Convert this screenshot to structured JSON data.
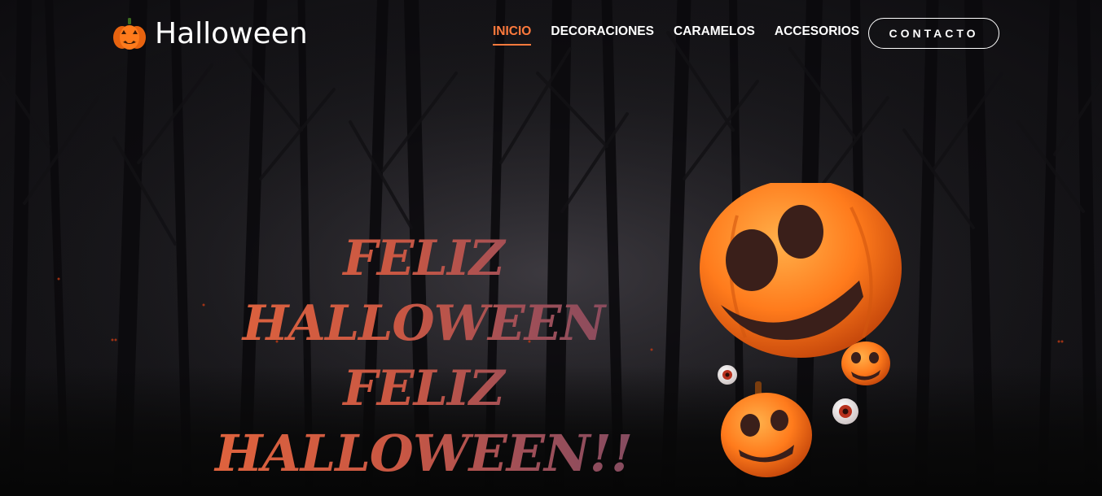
{
  "header": {
    "brand_title": "Halloween",
    "brand_icon": "pumpkin-icon",
    "nav": [
      {
        "label": "INICIO",
        "active": true
      },
      {
        "label": "DECORACIONES",
        "active": false
      },
      {
        "label": "CARAMELOS",
        "active": false
      },
      {
        "label": "ACCESORIOS",
        "active": false
      }
    ],
    "contact_label": "CONTACTO"
  },
  "hero": {
    "line1": "Feliz Halloween",
    "line2": "Feliz",
    "line3": "Halloween!!"
  },
  "colors": {
    "accent": "#ff7a3d",
    "pumpkin": "#ff7b1c",
    "text_gradient_start": "#e3653c",
    "text_gradient_end": "#7b4a63"
  }
}
